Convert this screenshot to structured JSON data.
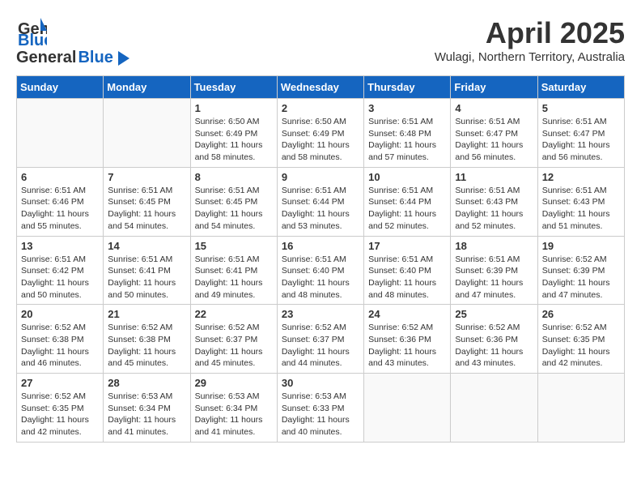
{
  "header": {
    "logo_general": "General",
    "logo_blue": "Blue",
    "month": "April 2025",
    "location": "Wulagi, Northern Territory, Australia"
  },
  "weekdays": [
    "Sunday",
    "Monday",
    "Tuesday",
    "Wednesday",
    "Thursday",
    "Friday",
    "Saturday"
  ],
  "weeks": [
    [
      {
        "day": "",
        "sunrise": "",
        "sunset": "",
        "daylight": ""
      },
      {
        "day": "",
        "sunrise": "",
        "sunset": "",
        "daylight": ""
      },
      {
        "day": "1",
        "sunrise": "Sunrise: 6:50 AM",
        "sunset": "Sunset: 6:49 PM",
        "daylight": "Daylight: 11 hours and 58 minutes."
      },
      {
        "day": "2",
        "sunrise": "Sunrise: 6:50 AM",
        "sunset": "Sunset: 6:49 PM",
        "daylight": "Daylight: 11 hours and 58 minutes."
      },
      {
        "day": "3",
        "sunrise": "Sunrise: 6:51 AM",
        "sunset": "Sunset: 6:48 PM",
        "daylight": "Daylight: 11 hours and 57 minutes."
      },
      {
        "day": "4",
        "sunrise": "Sunrise: 6:51 AM",
        "sunset": "Sunset: 6:47 PM",
        "daylight": "Daylight: 11 hours and 56 minutes."
      },
      {
        "day": "5",
        "sunrise": "Sunrise: 6:51 AM",
        "sunset": "Sunset: 6:47 PM",
        "daylight": "Daylight: 11 hours and 56 minutes."
      }
    ],
    [
      {
        "day": "6",
        "sunrise": "Sunrise: 6:51 AM",
        "sunset": "Sunset: 6:46 PM",
        "daylight": "Daylight: 11 hours and 55 minutes."
      },
      {
        "day": "7",
        "sunrise": "Sunrise: 6:51 AM",
        "sunset": "Sunset: 6:45 PM",
        "daylight": "Daylight: 11 hours and 54 minutes."
      },
      {
        "day": "8",
        "sunrise": "Sunrise: 6:51 AM",
        "sunset": "Sunset: 6:45 PM",
        "daylight": "Daylight: 11 hours and 54 minutes."
      },
      {
        "day": "9",
        "sunrise": "Sunrise: 6:51 AM",
        "sunset": "Sunset: 6:44 PM",
        "daylight": "Daylight: 11 hours and 53 minutes."
      },
      {
        "day": "10",
        "sunrise": "Sunrise: 6:51 AM",
        "sunset": "Sunset: 6:44 PM",
        "daylight": "Daylight: 11 hours and 52 minutes."
      },
      {
        "day": "11",
        "sunrise": "Sunrise: 6:51 AM",
        "sunset": "Sunset: 6:43 PM",
        "daylight": "Daylight: 11 hours and 52 minutes."
      },
      {
        "day": "12",
        "sunrise": "Sunrise: 6:51 AM",
        "sunset": "Sunset: 6:43 PM",
        "daylight": "Daylight: 11 hours and 51 minutes."
      }
    ],
    [
      {
        "day": "13",
        "sunrise": "Sunrise: 6:51 AM",
        "sunset": "Sunset: 6:42 PM",
        "daylight": "Daylight: 11 hours and 50 minutes."
      },
      {
        "day": "14",
        "sunrise": "Sunrise: 6:51 AM",
        "sunset": "Sunset: 6:41 PM",
        "daylight": "Daylight: 11 hours and 50 minutes."
      },
      {
        "day": "15",
        "sunrise": "Sunrise: 6:51 AM",
        "sunset": "Sunset: 6:41 PM",
        "daylight": "Daylight: 11 hours and 49 minutes."
      },
      {
        "day": "16",
        "sunrise": "Sunrise: 6:51 AM",
        "sunset": "Sunset: 6:40 PM",
        "daylight": "Daylight: 11 hours and 48 minutes."
      },
      {
        "day": "17",
        "sunrise": "Sunrise: 6:51 AM",
        "sunset": "Sunset: 6:40 PM",
        "daylight": "Daylight: 11 hours and 48 minutes."
      },
      {
        "day": "18",
        "sunrise": "Sunrise: 6:51 AM",
        "sunset": "Sunset: 6:39 PM",
        "daylight": "Daylight: 11 hours and 47 minutes."
      },
      {
        "day": "19",
        "sunrise": "Sunrise: 6:52 AM",
        "sunset": "Sunset: 6:39 PM",
        "daylight": "Daylight: 11 hours and 47 minutes."
      }
    ],
    [
      {
        "day": "20",
        "sunrise": "Sunrise: 6:52 AM",
        "sunset": "Sunset: 6:38 PM",
        "daylight": "Daylight: 11 hours and 46 minutes."
      },
      {
        "day": "21",
        "sunrise": "Sunrise: 6:52 AM",
        "sunset": "Sunset: 6:38 PM",
        "daylight": "Daylight: 11 hours and 45 minutes."
      },
      {
        "day": "22",
        "sunrise": "Sunrise: 6:52 AM",
        "sunset": "Sunset: 6:37 PM",
        "daylight": "Daylight: 11 hours and 45 minutes."
      },
      {
        "day": "23",
        "sunrise": "Sunrise: 6:52 AM",
        "sunset": "Sunset: 6:37 PM",
        "daylight": "Daylight: 11 hours and 44 minutes."
      },
      {
        "day": "24",
        "sunrise": "Sunrise: 6:52 AM",
        "sunset": "Sunset: 6:36 PM",
        "daylight": "Daylight: 11 hours and 43 minutes."
      },
      {
        "day": "25",
        "sunrise": "Sunrise: 6:52 AM",
        "sunset": "Sunset: 6:36 PM",
        "daylight": "Daylight: 11 hours and 43 minutes."
      },
      {
        "day": "26",
        "sunrise": "Sunrise: 6:52 AM",
        "sunset": "Sunset: 6:35 PM",
        "daylight": "Daylight: 11 hours and 42 minutes."
      }
    ],
    [
      {
        "day": "27",
        "sunrise": "Sunrise: 6:52 AM",
        "sunset": "Sunset: 6:35 PM",
        "daylight": "Daylight: 11 hours and 42 minutes."
      },
      {
        "day": "28",
        "sunrise": "Sunrise: 6:53 AM",
        "sunset": "Sunset: 6:34 PM",
        "daylight": "Daylight: 11 hours and 41 minutes."
      },
      {
        "day": "29",
        "sunrise": "Sunrise: 6:53 AM",
        "sunset": "Sunset: 6:34 PM",
        "daylight": "Daylight: 11 hours and 41 minutes."
      },
      {
        "day": "30",
        "sunrise": "Sunrise: 6:53 AM",
        "sunset": "Sunset: 6:33 PM",
        "daylight": "Daylight: 11 hours and 40 minutes."
      },
      {
        "day": "",
        "sunrise": "",
        "sunset": "",
        "daylight": ""
      },
      {
        "day": "",
        "sunrise": "",
        "sunset": "",
        "daylight": ""
      },
      {
        "day": "",
        "sunrise": "",
        "sunset": "",
        "daylight": ""
      }
    ]
  ]
}
